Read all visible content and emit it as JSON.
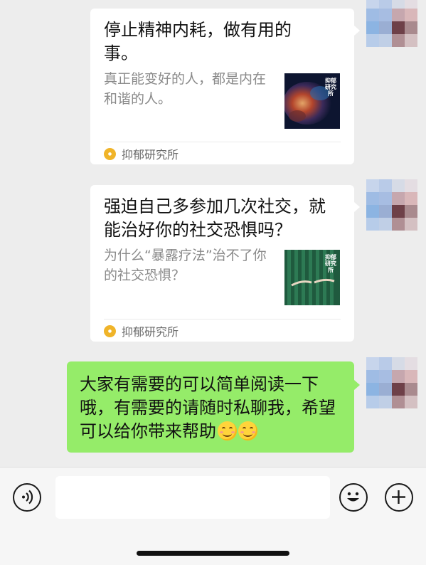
{
  "messages": [
    {
      "type": "article",
      "title": "停止精神内耗，做有用的事。",
      "description": "真正能变好的人，都是内在和谐的人。",
      "source": "抑郁研究所",
      "thumb_logo": "抑郁研究所"
    },
    {
      "type": "article",
      "title": "强迫自己多参加几次社交，就能治好你的社交恐惧吗？",
      "description": "为什么“暴露疗法”治不了你的社交恐惧？",
      "source": "抑郁研究所",
      "thumb_logo": "抑郁研究所"
    },
    {
      "type": "text",
      "text": "大家有需要的可以简单阅读一下哦，有需要的请随时私聊我，希望可以给你带来帮助",
      "emoji_icons": [
        "smiling-face-icon",
        "smiling-face-icon"
      ]
    }
  ],
  "input_bar": {
    "voice_icon": "voice-icon",
    "emoji_icon": "emoji-icon",
    "more_icon": "plus-icon",
    "input_value": ""
  },
  "colors": {
    "chat_background": "#ededed",
    "card_background": "#ffffff",
    "own_bubble": "#95ec69",
    "source_icon": "#f0b429"
  }
}
